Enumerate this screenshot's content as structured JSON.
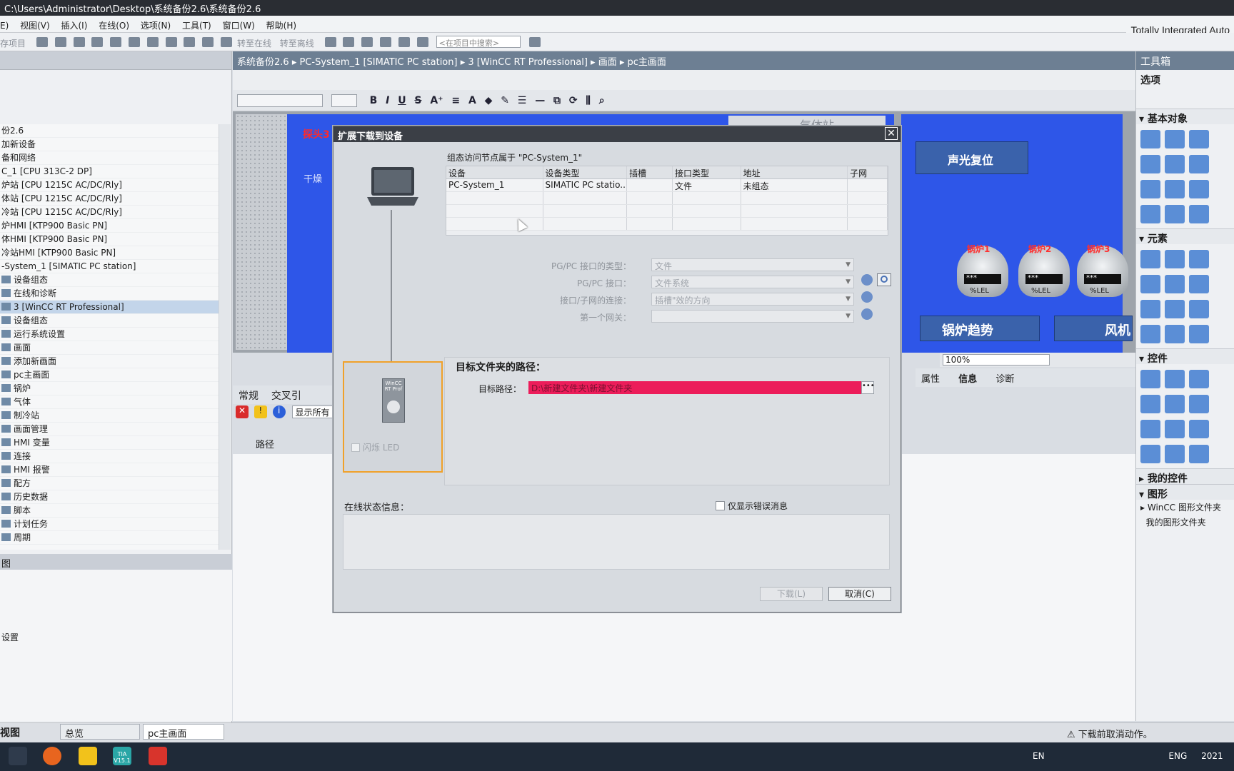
{
  "window": {
    "title": "C:\\Users\\Administrator\\Desktop\\系统备份2.6\\系统备份2.6",
    "brand": "Totally Integrated Auto"
  },
  "menu": [
    "E)",
    "视图(V)",
    "插入(I)",
    "在线(O)",
    "选项(N)",
    "工具(T)",
    "窗口(W)",
    "帮助(H)"
  ],
  "toolbar": {
    "save_label": "存项目",
    "go_online": "转至在线",
    "go_offline": "转至离线",
    "search_placeholder": "<在项目中搜索>"
  },
  "project_tree": [
    {
      "label": "份2.6",
      "selected": false
    },
    {
      "label": "加新设备",
      "selected": false
    },
    {
      "label": "备和网络",
      "selected": false
    },
    {
      "label": "C_1 [CPU 313C-2 DP]",
      "selected": false
    },
    {
      "label": "炉站 [CPU 1215C AC/DC/Rly]",
      "selected": false
    },
    {
      "label": "体站 [CPU 1215C AC/DC/Rly]",
      "selected": false
    },
    {
      "label": "冷站 [CPU 1215C AC/DC/Rly]",
      "selected": false
    },
    {
      "label": "炉HMI [KTP900 Basic PN]",
      "selected": false
    },
    {
      "label": "体HMI [KTP900 Basic PN]",
      "selected": false
    },
    {
      "label": "冷站HMI [KTP900 Basic PN]",
      "selected": false
    },
    {
      "label": "-System_1 [SIMATIC PC station]",
      "selected": false
    },
    {
      "label": "设备组态",
      "selected": false
    },
    {
      "label": "在线和诊断",
      "selected": false
    },
    {
      "label": "3 [WinCC RT Professional]",
      "selected": true
    },
    {
      "label": "设备组态",
      "selected": false
    },
    {
      "label": "运行系统设置",
      "selected": false
    },
    {
      "label": "画面",
      "selected": false
    },
    {
      "label": "添加新画面",
      "selected": false
    },
    {
      "label": "pc主画面",
      "selected": false
    },
    {
      "label": "锅炉",
      "selected": false
    },
    {
      "label": "气体",
      "selected": false
    },
    {
      "label": "制冷站",
      "selected": false
    },
    {
      "label": "画面管理",
      "selected": false
    },
    {
      "label": "HMI 变量",
      "selected": false
    },
    {
      "label": "连接",
      "selected": false
    },
    {
      "label": "HMI 报警",
      "selected": false
    },
    {
      "label": "配方",
      "selected": false
    },
    {
      "label": "历史数据",
      "selected": false
    },
    {
      "label": "脚本",
      "selected": false
    },
    {
      "label": "计划任务",
      "selected": false
    },
    {
      "label": "周期",
      "selected": false
    }
  ],
  "details": {
    "title": "图",
    "item": "设置"
  },
  "breadcrumb": [
    "系统备份2.6",
    "PC-System_1 [SIMATIC PC station]",
    "3 [WinCC RT Professional]",
    "画面",
    "pc主画面"
  ],
  "canvas": {
    "red_label": "探头3",
    "blue_label": "干燥",
    "tab_label": "气体站",
    "alarm_reset": "声光复位",
    "boilers": [
      "锅炉1",
      "锅炉2",
      "锅炉3"
    ],
    "boiler_display": "***",
    "boiler_unit": "%LEL",
    "trend_button": "锅炉趋势",
    "fan_button": "风机",
    "zoom": "100%"
  },
  "inspector_tabs": [
    "属性",
    "信息",
    "诊断"
  ],
  "bottom_tabs": [
    "常规",
    "交叉引"
  ],
  "bottom_show_all": "显示所有",
  "bottom_path_header": "路径",
  "toolbox": {
    "title": "工具箱",
    "options": "选项",
    "categories": [
      "基本对象",
      "元素",
      "控件",
      "我的控件",
      "图形"
    ],
    "folders": [
      "WinCC 图形文件夹",
      "我的图形文件夹"
    ]
  },
  "dialog": {
    "title": "扩展下载到设备",
    "config_node": "组态访问节点属于 \"PC-System_1\"",
    "table_headers": [
      "设备",
      "设备类型",
      "插槽",
      "接口类型",
      "地址",
      "子网"
    ],
    "table_rows": [
      [
        "PC-System_1",
        "SIMATIC PC statio...",
        "",
        "文件",
        "未组态",
        ""
      ]
    ],
    "pgpc_type_label": "PG/PC 接口的类型：",
    "pgpc_type_value": "文件",
    "pgpc_iface_label": "PG/PC 接口：",
    "pgpc_iface_value": "文件系统",
    "subnet_label": "接口/子网的连接：",
    "subnet_value": "插槽\"效的方向",
    "gateway_label": "第一个网关：",
    "gateway_value": "",
    "flash_led": "闪烁 LED",
    "device_text": "WinCC RT Prof",
    "target_title": "目标文件夹的路径：",
    "target_label": "目标路径：",
    "target_value": "D:\\新建文件夹\\新建文件夹",
    "online_info": "在线状态信息：",
    "errors_only": "仅显示错误消息",
    "download_btn": "下载(L)",
    "cancel_btn": "取消(C)"
  },
  "statusbar": {
    "view": "视图",
    "tab_overview": "总览",
    "tab_screen": "pc主画面",
    "message": "下载前取消动作。"
  },
  "taskbar": {
    "apps": [
      "firefox",
      "explorer",
      "tia-portal",
      "sogou"
    ],
    "tia_label": "TIA V15.1",
    "lang1": "EN",
    "lang2": "ENG",
    "clock": "2021"
  }
}
